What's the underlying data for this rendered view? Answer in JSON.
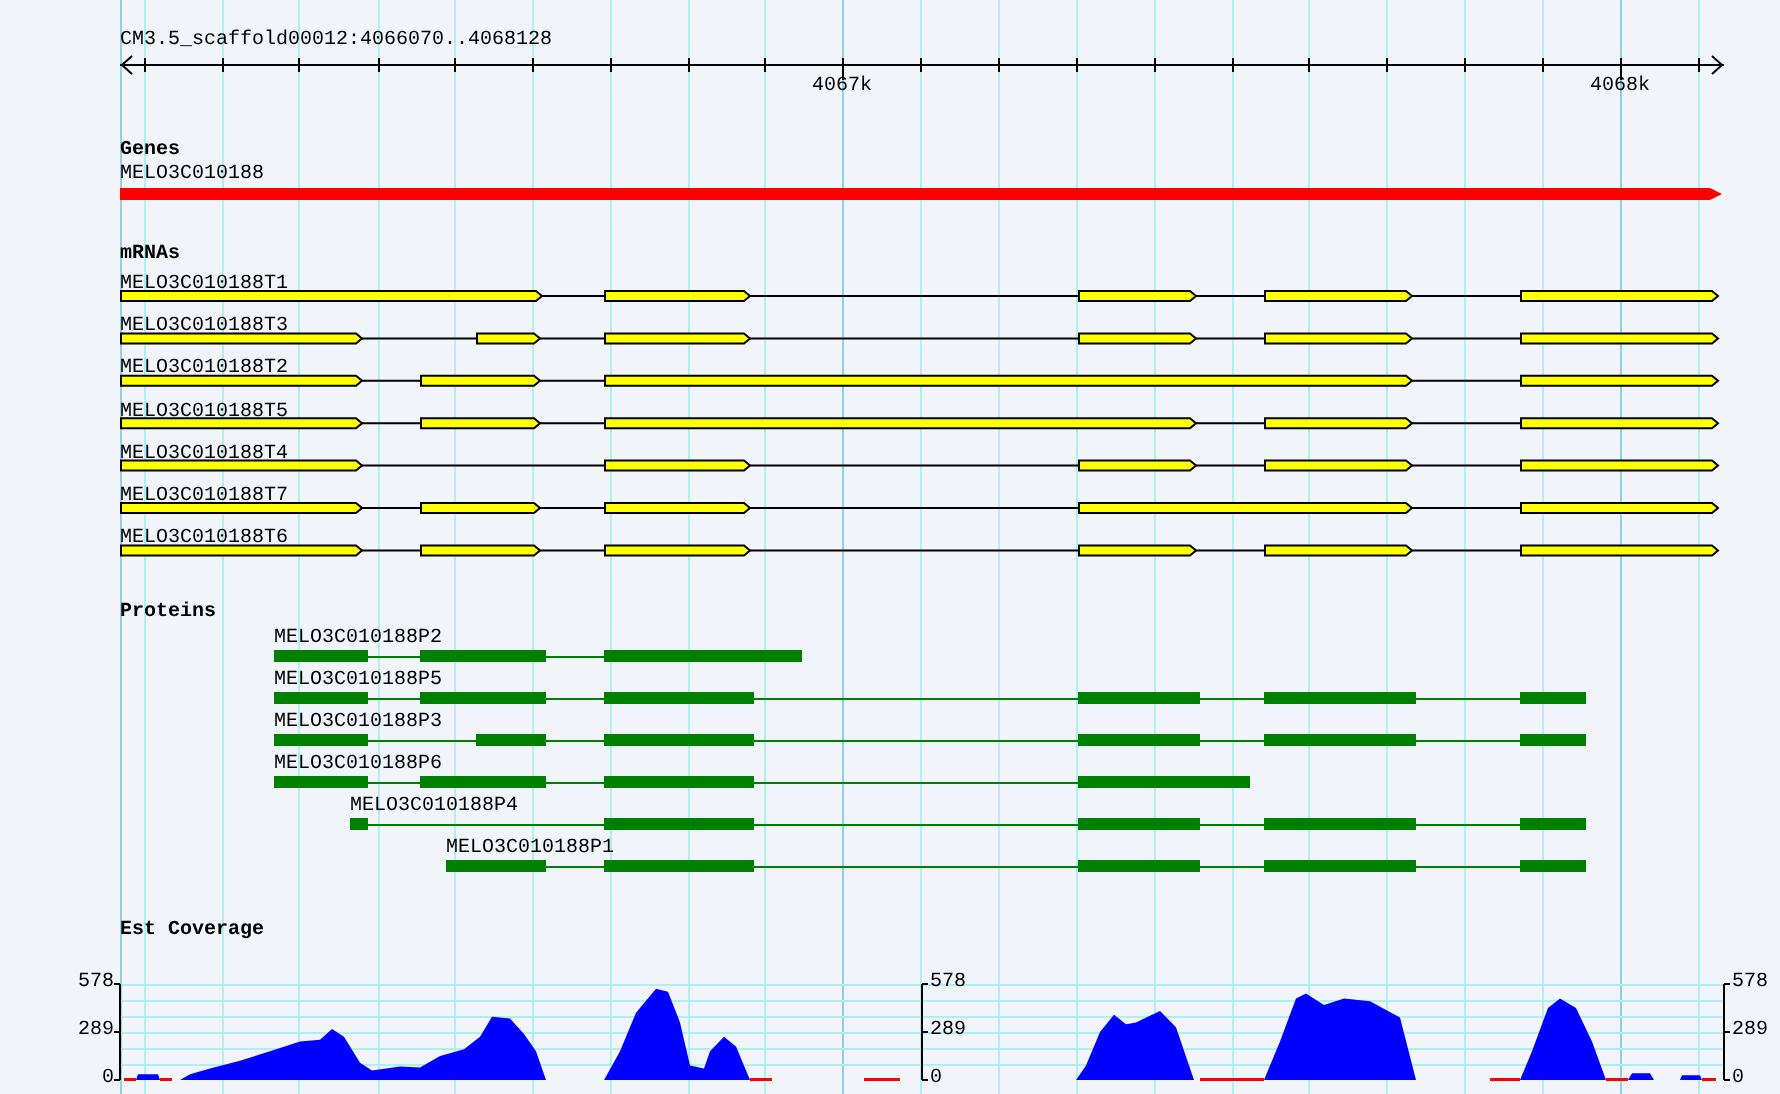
{
  "ruler": {
    "title": "CM3.5_scaffold00012:4066070..4068128",
    "ticks": [
      "4067k",
      "4068k"
    ]
  },
  "tracks": [
    {
      "kind": "genes",
      "title": "Genes",
      "features": [
        {
          "name": "MELO3C010188"
        }
      ]
    },
    {
      "kind": "mrnas",
      "title": "mRNAs",
      "features": [
        {
          "name": "MELO3C010188T1"
        },
        {
          "name": "MELO3C010188T3"
        },
        {
          "name": "MELO3C010188T2"
        },
        {
          "name": "MELO3C010188T5"
        },
        {
          "name": "MELO3C010188T4"
        },
        {
          "name": "MELO3C010188T7"
        },
        {
          "name": "MELO3C010188T6"
        }
      ]
    },
    {
      "kind": "proteins",
      "title": "Proteins",
      "features": [
        {
          "name": "MELO3C010188P2"
        },
        {
          "name": "MELO3C010188P5"
        },
        {
          "name": "MELO3C010188P3"
        },
        {
          "name": "MELO3C010188P6"
        },
        {
          "name": "MELO3C010188P4"
        },
        {
          "name": "MELO3C010188P1"
        }
      ]
    },
    {
      "kind": "coverage",
      "title": "Est Coverage",
      "axes": [
        {
          "labels": [
            "578",
            "289",
            "0"
          ]
        },
        {
          "labels": [
            "578",
            "289",
            "0"
          ]
        },
        {
          "labels": [
            "578",
            "289",
            "0"
          ]
        }
      ]
    }
  ]
}
